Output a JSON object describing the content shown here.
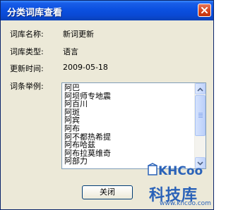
{
  "window": {
    "title": "分类词库查看"
  },
  "fields": {
    "name_label": "词库名称:",
    "name_value": "新词更新",
    "type_label": "词库类型:",
    "type_value": "语言",
    "time_label": "更新时间:",
    "time_value": "2009-05-18",
    "examples_label": "词条举例:"
  },
  "examples": [
    "阿巴",
    "阿坝师专地震",
    "阿百川",
    "阿斑",
    "阿宾",
    "阿布",
    "阿不都热希提",
    "阿布哈兹",
    "阿布拉莫维奇",
    "阿部力"
  ],
  "buttons": {
    "close_label": "关闭"
  },
  "watermark": {
    "logo": "KHCoo",
    "title": "科技库",
    "url": "www.khcoo.com"
  },
  "colors": {
    "titlebar": "#0a49d4",
    "dialog_bg": "#ece9d8",
    "close_button": "#d6451d",
    "watermark": "#2a62b8"
  }
}
